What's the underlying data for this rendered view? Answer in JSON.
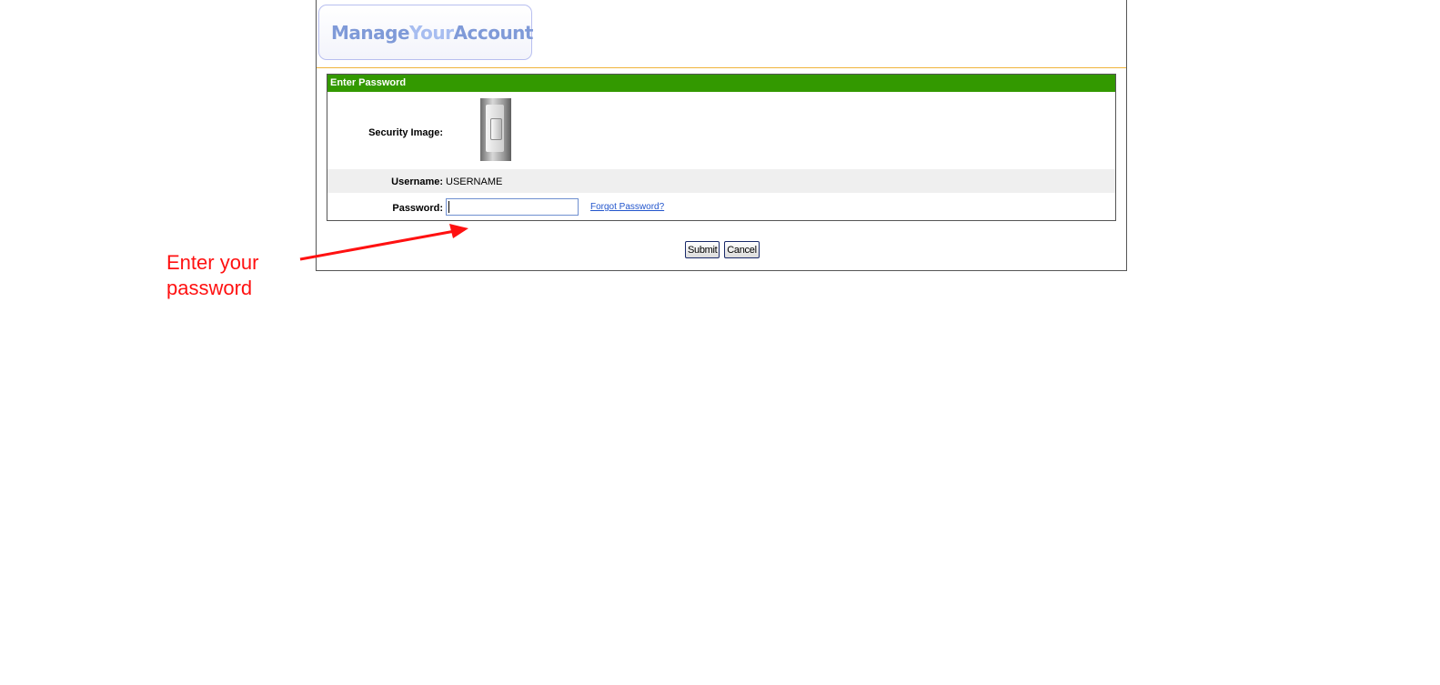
{
  "logo": {
    "part1": "Manage",
    "part2": "Your",
    "part3": "Account"
  },
  "panel": {
    "title": "Enter Password"
  },
  "security": {
    "label": "Security Image:"
  },
  "username": {
    "label": "Username:",
    "value": "USERNAME"
  },
  "password": {
    "label": "Password:",
    "value": "",
    "placeholder": ""
  },
  "forgot_link": "Forgot Password?",
  "buttons": {
    "submit": "Submit",
    "cancel": "Cancel"
  },
  "annotation": {
    "line1": "Enter your",
    "line2": "password"
  },
  "colors": {
    "header_bar": "#339900",
    "rule": "#f0b43a",
    "annotation": "#ff1111",
    "link": "#2255cc"
  }
}
